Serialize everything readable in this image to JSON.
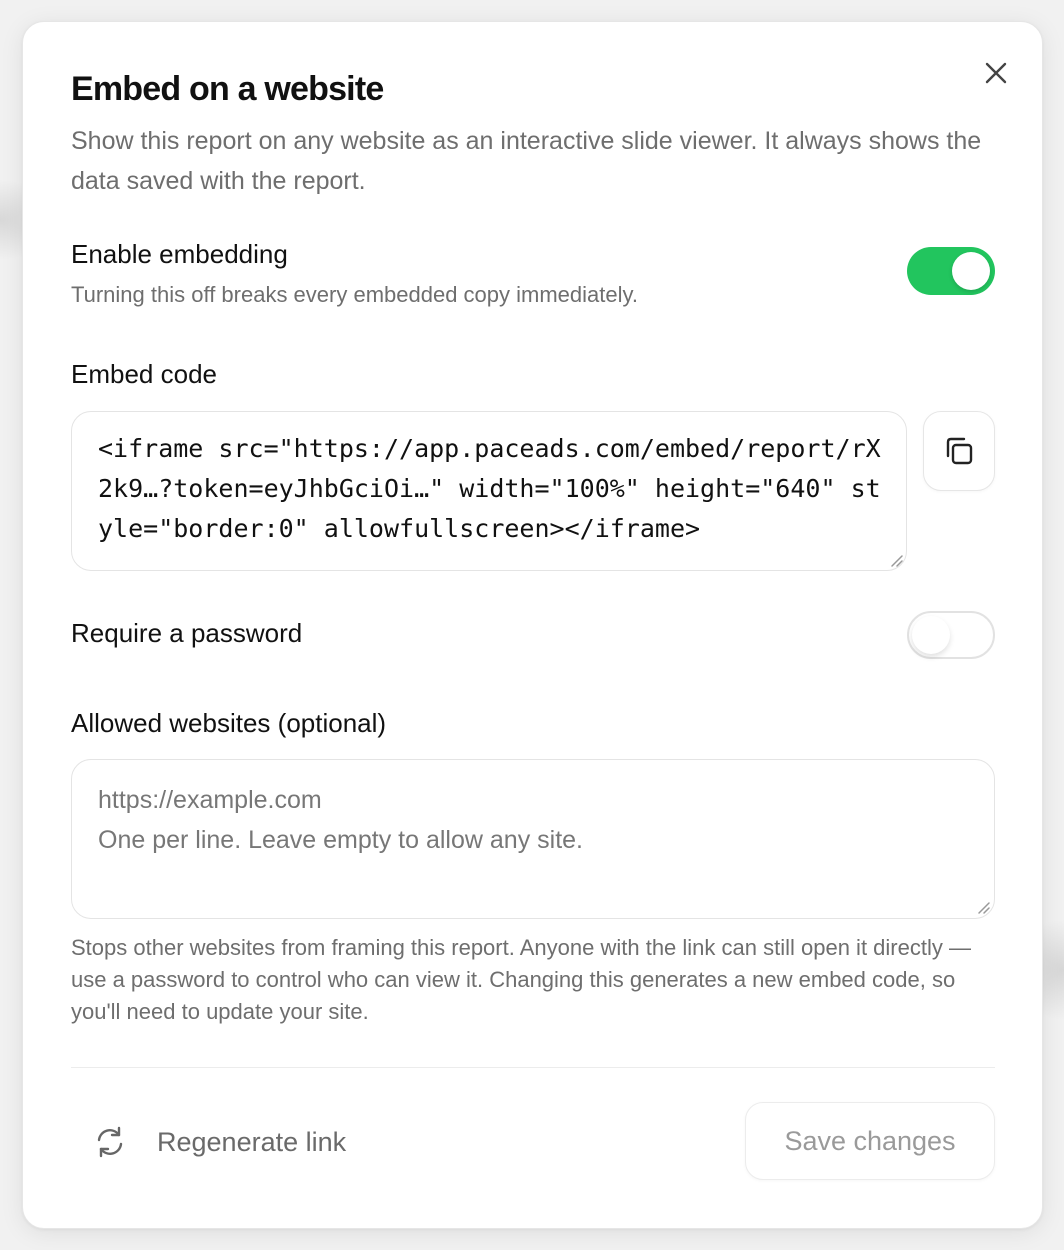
{
  "dialog": {
    "title": "Embed on a website",
    "subtitle": "Show this report on any website as an interactive slide viewer. It always shows the data saved with the report."
  },
  "enable_embedding": {
    "label": "Enable embedding",
    "description": "Turning this off breaks every embedded copy immediately.",
    "state": "on"
  },
  "embed_code": {
    "label": "Embed code",
    "value": "<iframe src=\"https://app.paceads.com/embed/report/rX2k9…?token=eyJhbGciOi…\" width=\"100%\" height=\"640\" style=\"border:0\" allowfullscreen></iframe>",
    "copy_icon": "copy-icon"
  },
  "require_password": {
    "label": "Require a password",
    "state": "off"
  },
  "allowed_websites": {
    "label": "Allowed websites (optional)",
    "placeholder": "https://example.com\nOne per line. Leave empty to allow any site.",
    "value": "",
    "help": "Stops other websites from framing this report. Anyone with the link can still open it directly — use a password to control who can view it. Changing this generates a new embed code, so you'll need to update your site."
  },
  "footer": {
    "regenerate_label": "Regenerate link",
    "regenerate_icon": "refresh-icon",
    "save_label": "Save changes"
  },
  "colors": {
    "toggle_on": "#22c55e",
    "text_primary": "#111111",
    "text_muted": "#6e6e6e"
  }
}
